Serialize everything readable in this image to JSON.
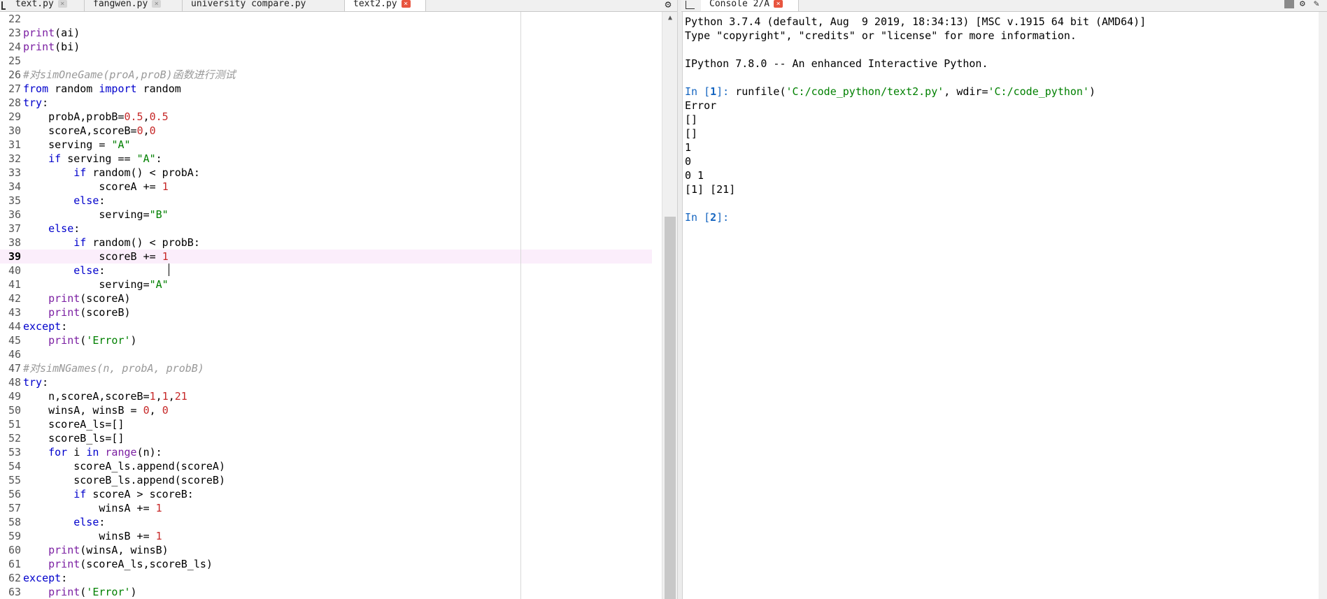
{
  "editor_tabs": [
    {
      "label": "text.py",
      "active": false
    },
    {
      "label": "fangwen.py",
      "active": false
    },
    {
      "label": "university  compare.py",
      "active": false
    },
    {
      "label": "text2.py",
      "active": true
    }
  ],
  "tab_close_glyph": "×",
  "console_tab": {
    "label": "Console 2/A",
    "close_glyph": "×"
  },
  "icons": {
    "gear": "gear-icon",
    "pane": "pane-toggle-icon",
    "stop": "stop-icon",
    "options": "options-icon",
    "extra": "extra-icon"
  },
  "editor": {
    "first_line": 22,
    "current_line": 39,
    "lines": [
      "",
      "print(ai)",
      "print(bi)",
      "",
      "#对simOneGame(proA,proB)函数进行测试",
      "from random import random",
      "try:",
      "    probA,probB=0.5,0.5",
      "    scoreA,scoreB=0,0",
      "    serving = \"A\"",
      "    if serving == \"A\":",
      "        if random() < probA:",
      "            scoreA += 1",
      "        else:",
      "            serving=\"B\"",
      "    else:",
      "        if random() < probB:",
      "            scoreB += 1",
      "        else:",
      "            serving=\"A\"",
      "    print(scoreA)",
      "    print(scoreB)",
      "except:",
      "    print('Error')",
      "",
      "#对simNGames(n, probA, probB)",
      "try:",
      "    n,scoreA,scoreB=1,1,21",
      "    winsA, winsB = 0, 0",
      "    scoreA_ls=[]",
      "    scoreB_ls=[]",
      "    for i in range(n):",
      "        scoreA_ls.append(scoreA)",
      "        scoreB_ls.append(scoreB)",
      "        if scoreA > scoreB:",
      "            winsA += 1",
      "        else:",
      "            winsB += 1",
      "    print(winsA, winsB)",
      "    print(scoreA_ls,scoreB_ls)",
      "except:",
      "    print('Error')"
    ]
  },
  "console": {
    "banner1": "Python 3.7.4 (default, Aug  9 2019, 18:34:13) [MSC v.1915 64 bit (AMD64)]",
    "banner2": "Type \"copyright\", \"credits\" or \"license\" for more information.",
    "banner3": "IPython 7.8.0 -- An enhanced Interactive Python.",
    "in1_prefix": "In [",
    "in1_num": "1",
    "in1_suffix": "]: ",
    "in1_cmd_a": "runfile(",
    "in1_str1": "'C:/code_python/text2.py'",
    "in1_cmd_b": ", wdir=",
    "in1_str2": "'C:/code_python'",
    "in1_cmd_c": ")",
    "outputs": [
      "Error",
      "[]",
      "[]",
      "1",
      "0",
      "0 1",
      "[1] [21]"
    ],
    "in2_prefix": "In [",
    "in2_num": "2",
    "in2_suffix": "]: "
  },
  "colors": {
    "keyword": "#0000cc",
    "builtin": "#7b1fa2",
    "string": "#008000",
    "number": "#c62828",
    "comment": "#999999",
    "current_line_bg": "#fbeefb",
    "prompt": "#1565c0"
  }
}
